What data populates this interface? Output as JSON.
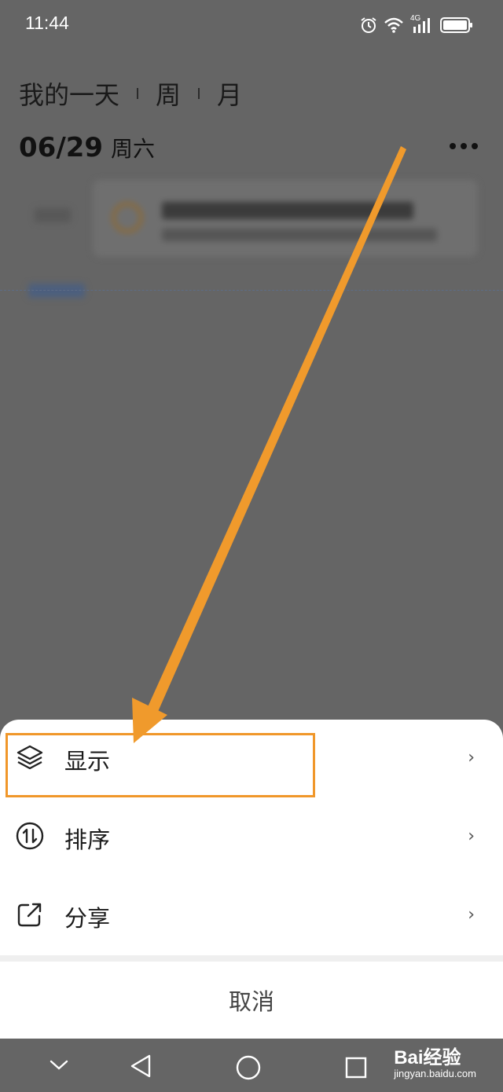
{
  "status_bar": {
    "time": "11:44",
    "network": "4G"
  },
  "header": {
    "tabs": [
      {
        "label": "我的一天"
      },
      {
        "label": "周"
      },
      {
        "label": "月"
      }
    ],
    "date": "06/29",
    "weekday": "周六"
  },
  "sheet": {
    "items": [
      {
        "label": "显示",
        "icon": "layers-icon"
      },
      {
        "label": "排序",
        "icon": "sort-icon"
      },
      {
        "label": "分享",
        "icon": "share-icon"
      }
    ],
    "cancel_label": "取消"
  },
  "watermark": {
    "brand": "Bai经验",
    "url": "jingyan.baidu.com"
  },
  "colors": {
    "highlight": "#f0972a",
    "overlay": "#656565",
    "sheet": "#ffffff"
  }
}
